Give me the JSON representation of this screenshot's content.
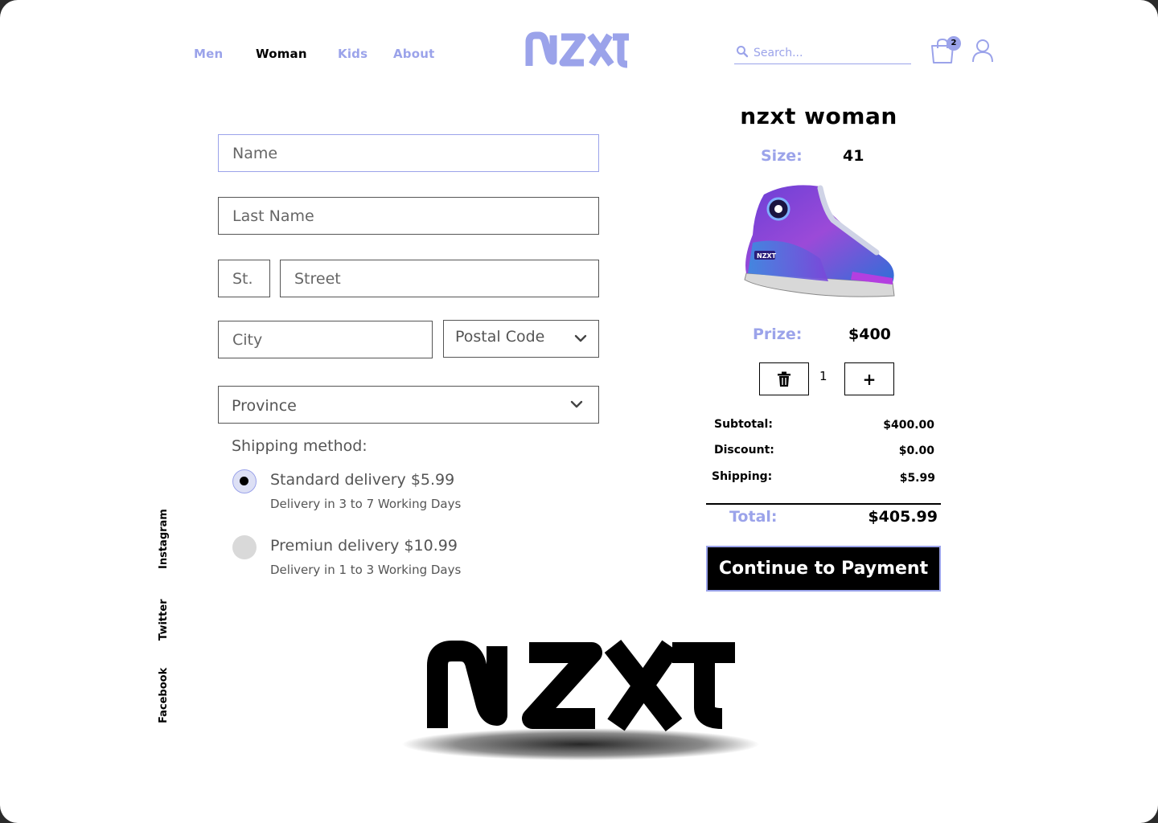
{
  "nav": {
    "links": [
      "Men",
      "Woman",
      "Kids",
      "About"
    ],
    "active": "Woman",
    "logo_text": "NZXT"
  },
  "search": {
    "placeholder": "Search..."
  },
  "cart": {
    "count": "2"
  },
  "form": {
    "name_placeholder": "Name",
    "last_name_placeholder": "Last Name",
    "street_number_placeholder": "St.",
    "street_placeholder": "Street",
    "city_placeholder": "City",
    "postal_code_label": "Postal Code",
    "province_label": "Province",
    "shipping_label": "Shipping method:",
    "shipping_options": [
      {
        "title": "Standard delivery $5.99",
        "subtitle": "Delivery in 3 to 7 Working Days",
        "selected": true
      },
      {
        "title": "Premiun delivery $10.99",
        "subtitle": "Delivery in 1 to 3 Working Days",
        "selected": false
      }
    ]
  },
  "social": [
    "Instagram",
    "Twitter",
    "Facebook"
  ],
  "summary": {
    "product_title": "nzxt woman",
    "size_label": "Size:",
    "size_value": "41",
    "price_label": "Prize:",
    "price_value": "$400",
    "quantity": "1",
    "plus_label": "+",
    "subtotal_label": "Subtotal:",
    "subtotal_value": "$400.00",
    "discount_label": "Discount:",
    "discount_value": "$0.00",
    "shipping_label": "Shipping:",
    "shipping_value": "$5.99",
    "total_label": "Total:",
    "total_value": "$405.99",
    "pay_button": "Continue to Payment"
  },
  "footer": {
    "logo_text": "NZXT"
  },
  "colors": {
    "accent": "#9ba3ea",
    "text": "#000000",
    "muted": "#555555"
  }
}
